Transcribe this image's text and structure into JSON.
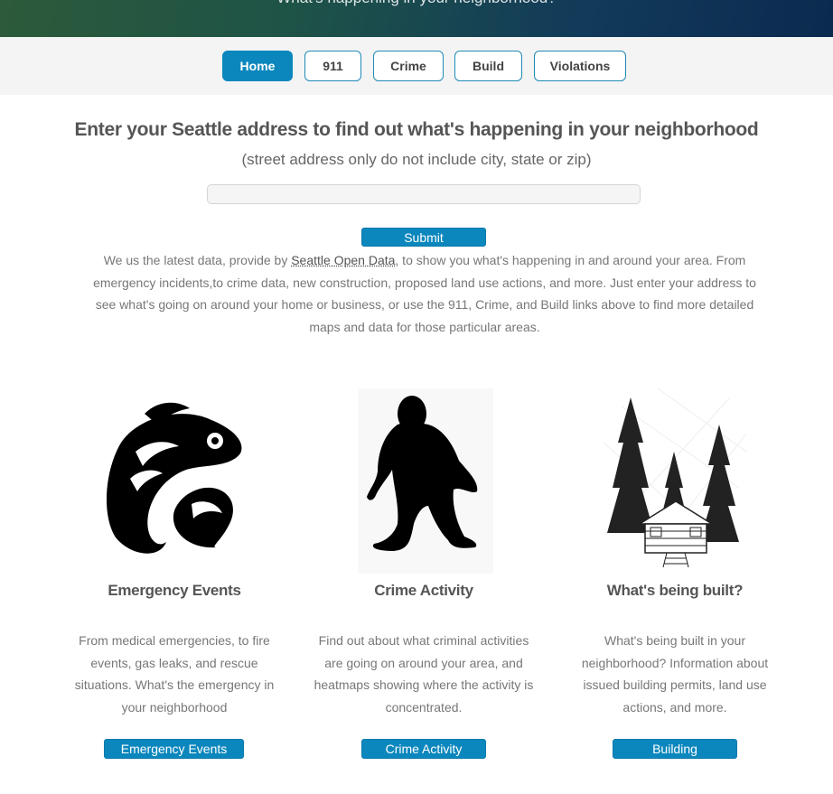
{
  "hero": {
    "tagline": "What's happening in your neighborhood?"
  },
  "nav": {
    "home": "Home",
    "n911": "911",
    "crime": "Crime",
    "build": "Build",
    "violations": "Violations"
  },
  "search": {
    "headline": "Enter your Seattle address to find out what's happening in your neighborhood",
    "subhead": "(street address only do not include city, state or zip)",
    "address_value": "",
    "submit_label": "Submit"
  },
  "intro": {
    "before_link": "We us the latest data, provide by ",
    "link_text": "Seattle Open Data",
    "after_link": ", to show you what's happening in and around your area. From emergency incidents,to crime data, new construction, proposed land use actions, and more. Just enter your address to see what's going on around your home or business, or use the 911, Crime, and Build links above to find more detailed maps and data for those particular areas."
  },
  "cards": {
    "emergency": {
      "icon": "salmon-icon",
      "title": "Emergency Events",
      "text": "From medical emergencies, to fire events, gas leaks, and rescue situations. What's the emergency in your neighborhood",
      "button": "Emergency Events"
    },
    "crime": {
      "icon": "bigfoot-icon",
      "title": "Crime Activity",
      "text": "Find out about what criminal activities are going on around your area, and heatmaps showing where the activity is concentrated.",
      "button": "Crime Activity"
    },
    "build": {
      "icon": "cabin-trees-icon",
      "title": "What's being built?",
      "text": "What's being built in your neighborhood? Information about issued building permits, land use actions, and more.",
      "button": "Building"
    }
  },
  "colors": {
    "accent": "#0b87bd",
    "nav_border": "#1f8bb6",
    "text": "#777777"
  }
}
